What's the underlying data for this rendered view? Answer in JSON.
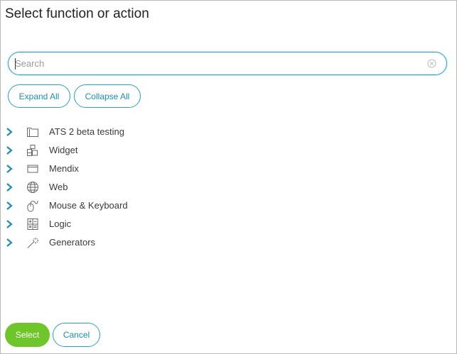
{
  "dialog": {
    "title": "Select function or action"
  },
  "search": {
    "placeholder": "Search",
    "value": ""
  },
  "tree_controls": {
    "expand_all": "Expand All",
    "collapse_all": "Collapse All"
  },
  "tree": {
    "items": [
      {
        "label": "ATS 2 beta testing",
        "icon": "folder-icon"
      },
      {
        "label": "Widget",
        "icon": "widget-blocks-icon"
      },
      {
        "label": "Mendix",
        "icon": "window-icon"
      },
      {
        "label": "Web",
        "icon": "globe-icon"
      },
      {
        "label": "Mouse & Keyboard",
        "icon": "mouse-icon"
      },
      {
        "label": "Logic",
        "icon": "calculator-icon"
      },
      {
        "label": "Generators",
        "icon": "magic-wand-icon"
      }
    ]
  },
  "footer": {
    "select": "Select",
    "cancel": "Cancel"
  },
  "colors": {
    "accent": "#29a0c8",
    "primary_button": "#6fc62a",
    "chevron": "#1e8db8"
  }
}
